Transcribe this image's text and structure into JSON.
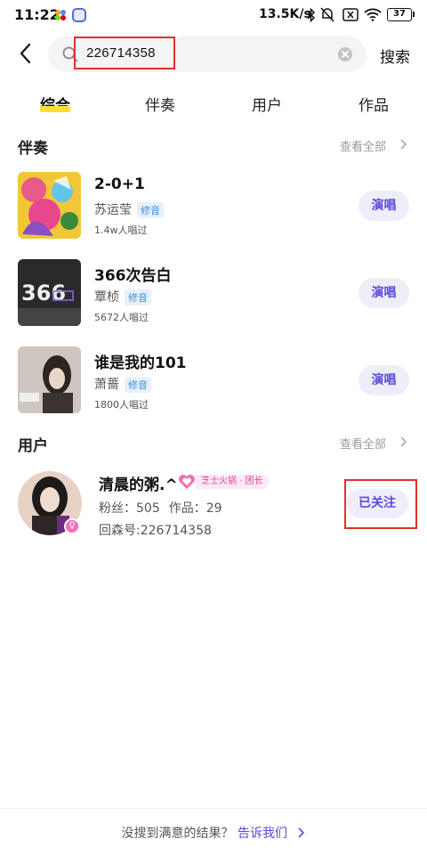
{
  "status_bar": {
    "time": "11:22",
    "network_speed": "13.5K/s",
    "battery": "37"
  },
  "search": {
    "query": "226714358",
    "submit_label": "搜索"
  },
  "tabs": [
    {
      "label": "综合",
      "active": true
    },
    {
      "label": "伴奏",
      "active": false
    },
    {
      "label": "用户",
      "active": false
    },
    {
      "label": "作品",
      "active": false
    }
  ],
  "accompaniment_section": {
    "title": "伴奏",
    "view_all": "查看全部",
    "items": [
      {
        "title": "2-0+1",
        "artist": "苏运莹",
        "tag": "修音",
        "count": "1.4w人唱过",
        "action": "演唱"
      },
      {
        "title": "366次告白",
        "artist": "覃桢",
        "tag": "修音",
        "count": "5672人唱过",
        "action": "演唱"
      },
      {
        "title": "谁是我的101",
        "artist": "萧蔷",
        "tag": "修音",
        "count": "1800人唱过",
        "action": "演唱"
      }
    ]
  },
  "user_section": {
    "title": "用户",
    "view_all": "查看全部",
    "user": {
      "name": "清晨的粥.^",
      "badge": "芝士火锅 · 团长",
      "fans": "粉丝：505",
      "works": "作品：29",
      "id": "回森号:226714358",
      "follow_label": "已关注"
    }
  },
  "footer": {
    "text": "没搜到满意的结果？",
    "link": "告诉我们"
  },
  "colors": {
    "accent": "#5a4bd6",
    "tab_underline": "#ffdc38",
    "highlight": "#e23030"
  }
}
